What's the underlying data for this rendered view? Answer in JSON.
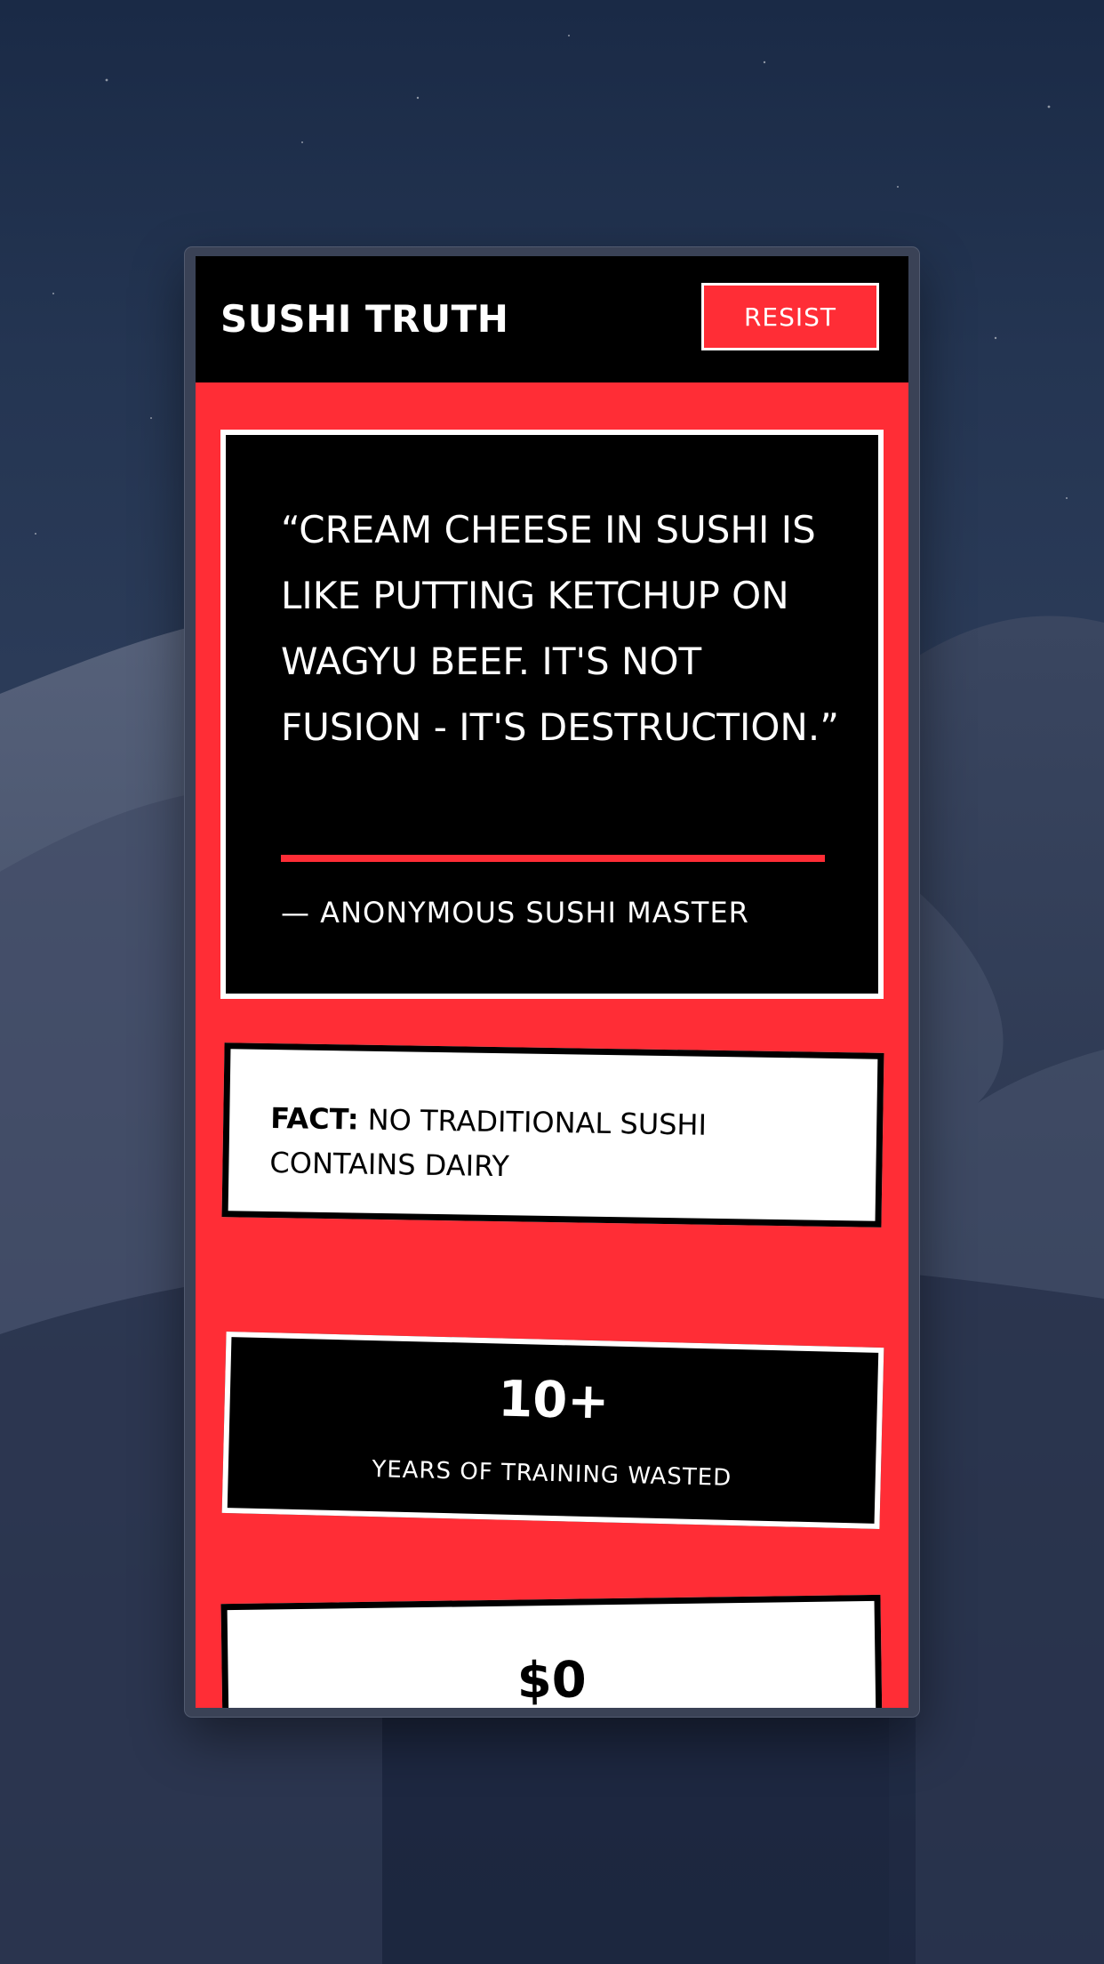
{
  "header": {
    "brand": "SUSHI TRUTH",
    "cta_label": "RESIST"
  },
  "quote": {
    "text": "“CREAM CHEESE IN SUSHI IS LIKE PUTTING KETCHUP ON WAGYU BEEF. IT'S NOT FUSION - IT'S DESTRUCTION.”",
    "attribution": "— ANONYMOUS SUSHI MASTER"
  },
  "fact": {
    "label": "FACT:",
    "text": "NO TRADITIONAL SUSHI CONTAINS DAIRY"
  },
  "stats": [
    {
      "value": "10+",
      "label": "YEARS OF TRAINING WASTED"
    },
    {
      "value": "$0"
    }
  ],
  "colors": {
    "accent": "#ff2d36",
    "dark": "#000000",
    "light": "#ffffff"
  }
}
